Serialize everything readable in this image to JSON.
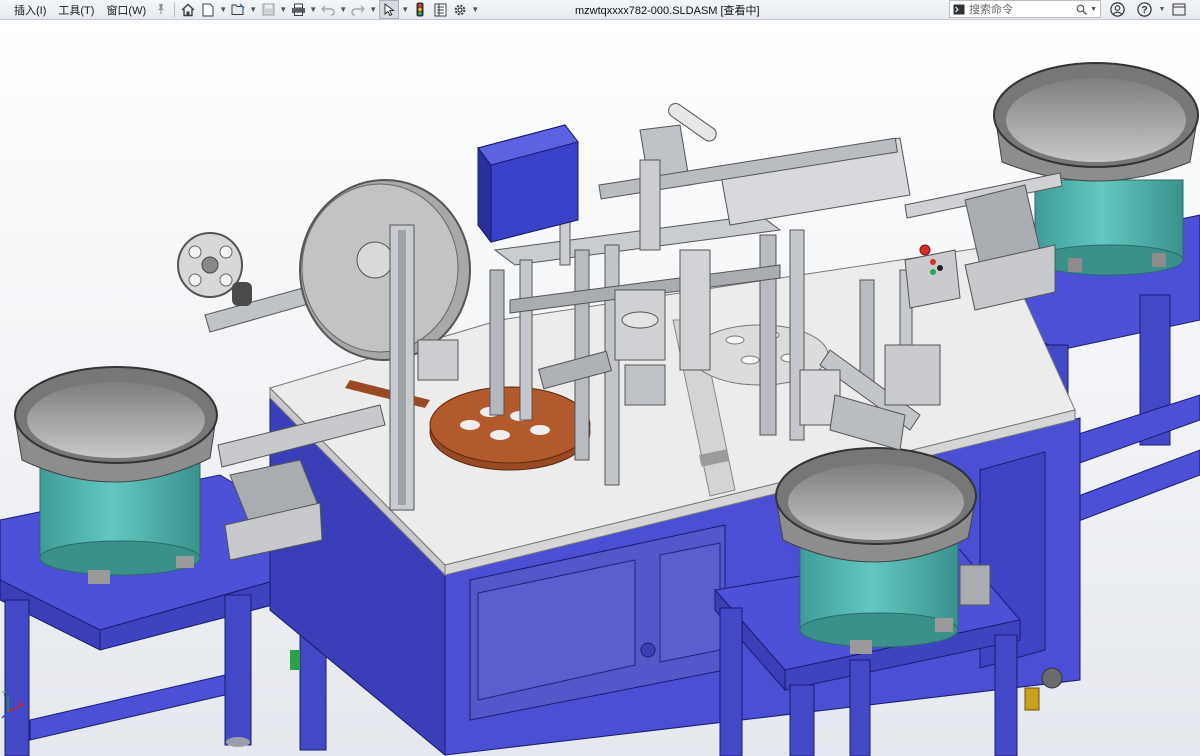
{
  "menu": {
    "insert": "插入(I)",
    "tools": "工具(T)",
    "window": "窗口(W)"
  },
  "document_title": "mzwtqxxxx782-000.SLDASM [查看中]",
  "search": {
    "placeholder": "搜索命令"
  },
  "icons": {
    "pin": "pin-icon",
    "home": "home-icon",
    "new": "new-document-icon",
    "open": "open-icon",
    "save": "save-icon",
    "print": "print-icon",
    "undo": "undo-icon",
    "redo": "redo-icon",
    "select": "select-arrow-icon",
    "rebuild": "traffic-light-icon",
    "file_props": "file-properties-icon",
    "options": "gear-icon",
    "terminal": "terminal-icon",
    "search": "search-icon",
    "user": "user-icon",
    "help": "help-icon",
    "window_menu": "window-menu-icon",
    "zoom_fit": "zoom-to-fit-icon",
    "zoom_area": "zoom-area-icon",
    "previous_view": "previous-view-icon",
    "section_view": "section-view-icon",
    "dynamic_annotation": "dynamic-annotation-icon",
    "view_orientation": "view-orientation-icon",
    "display_style": "display-style-icon",
    "hide_show": "hide-show-icon",
    "appearance": "appearance-icon",
    "scene": "scene-icon",
    "view_settings": "view-settings-icon",
    "restore": "restore-icon",
    "close": "close-icon",
    "triad": "axis-triad-icon"
  },
  "triad_axes": {
    "x": "x",
    "y": "Y"
  },
  "colors": {
    "frame_blue": "#4b4fd8",
    "table_top": "#ececec",
    "bowl_teal": "#4fb3ad",
    "bowl_gray": "#8d8d8d",
    "control_box": "#3a42c9",
    "rotary_table": "#9a4a22"
  }
}
